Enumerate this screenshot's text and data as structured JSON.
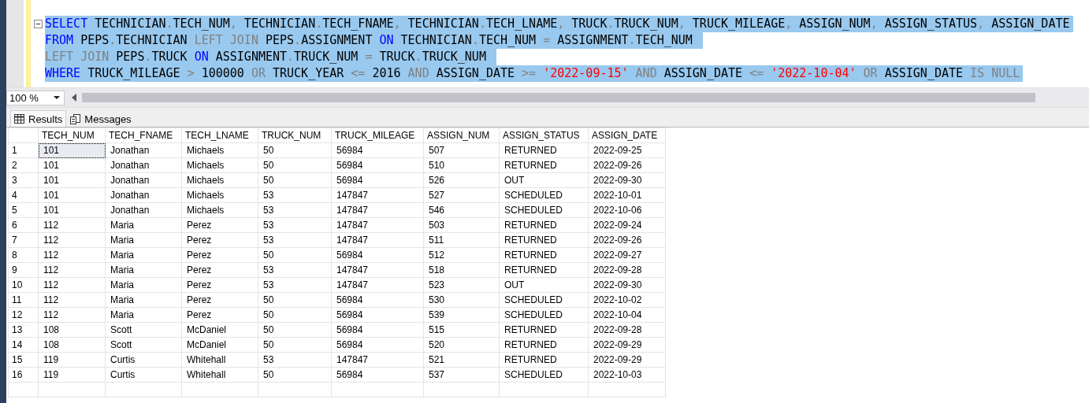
{
  "editor": {
    "lines": [
      {
        "selected": true,
        "collapsible": true,
        "tokens": [
          {
            "kind": "keyword",
            "text": "SELECT"
          },
          {
            "kind": "plain",
            "text": " TECHNICIAN"
          },
          {
            "kind": "gray",
            "text": "."
          },
          {
            "kind": "plain",
            "text": "TECH_NUM"
          },
          {
            "kind": "gray",
            "text": ","
          },
          {
            "kind": "plain",
            "text": " TECHNICIAN"
          },
          {
            "kind": "gray",
            "text": "."
          },
          {
            "kind": "plain",
            "text": "TECH_FNAME"
          },
          {
            "kind": "gray",
            "text": ","
          },
          {
            "kind": "plain",
            "text": " TECHNICIAN"
          },
          {
            "kind": "gray",
            "text": "."
          },
          {
            "kind": "plain",
            "text": "TECH_LNAME"
          },
          {
            "kind": "gray",
            "text": ","
          },
          {
            "kind": "plain",
            "text": " TRUCK"
          },
          {
            "kind": "gray",
            "text": "."
          },
          {
            "kind": "plain",
            "text": "TRUCK_NUM"
          },
          {
            "kind": "gray",
            "text": ","
          },
          {
            "kind": "plain",
            "text": " TRUCK_MILEAGE"
          },
          {
            "kind": "gray",
            "text": ","
          },
          {
            "kind": "plain",
            "text": " ASSIGN_NUM"
          },
          {
            "kind": "gray",
            "text": ","
          },
          {
            "kind": "plain",
            "text": " ASSIGN_STATUS"
          },
          {
            "kind": "gray",
            "text": ","
          },
          {
            "kind": "plain",
            "text": " ASSIGN_DATE"
          }
        ]
      },
      {
        "selected": true,
        "collapsible": false,
        "tokens": [
          {
            "kind": "keyword",
            "text": "FROM"
          },
          {
            "kind": "plain",
            "text": " PEPS"
          },
          {
            "kind": "gray",
            "text": "."
          },
          {
            "kind": "plain",
            "text": "TECHNICIAN "
          },
          {
            "kind": "gray",
            "text": "LEFT JOIN"
          },
          {
            "kind": "plain",
            "text": " PEPS"
          },
          {
            "kind": "gray",
            "text": "."
          },
          {
            "kind": "plain",
            "text": "ASSIGNMENT "
          },
          {
            "kind": "keyword",
            "text": "ON"
          },
          {
            "kind": "plain",
            "text": " TECHNICIAN"
          },
          {
            "kind": "gray",
            "text": "."
          },
          {
            "kind": "plain",
            "text": "TECH_NUM "
          },
          {
            "kind": "gray",
            "text": "="
          },
          {
            "kind": "plain",
            "text": " ASSIGNMENT"
          },
          {
            "kind": "gray",
            "text": "."
          },
          {
            "kind": "plain",
            "text": "TECH_NUM "
          }
        ]
      },
      {
        "selected": true,
        "collapsible": false,
        "tokens": [
          {
            "kind": "gray",
            "text": "LEFT JOIN"
          },
          {
            "kind": "plain",
            "text": " PEPS"
          },
          {
            "kind": "gray",
            "text": "."
          },
          {
            "kind": "plain",
            "text": "TRUCK "
          },
          {
            "kind": "keyword",
            "text": "ON"
          },
          {
            "kind": "plain",
            "text": " ASSIGNMENT"
          },
          {
            "kind": "gray",
            "text": "."
          },
          {
            "kind": "plain",
            "text": "TRUCK_NUM "
          },
          {
            "kind": "gray",
            "text": "="
          },
          {
            "kind": "plain",
            "text": " TRUCK"
          },
          {
            "kind": "gray",
            "text": "."
          },
          {
            "kind": "plain",
            "text": "TRUCK_NUM "
          }
        ]
      },
      {
        "selected": true,
        "collapsible": false,
        "tokens": [
          {
            "kind": "keyword",
            "text": "WHERE"
          },
          {
            "kind": "plain",
            "text": " TRUCK_MILEAGE "
          },
          {
            "kind": "gray",
            "text": ">"
          },
          {
            "kind": "plain",
            "text": " 100000 "
          },
          {
            "kind": "gray",
            "text": "OR"
          },
          {
            "kind": "plain",
            "text": " TRUCK_YEAR "
          },
          {
            "kind": "gray",
            "text": "<="
          },
          {
            "kind": "plain",
            "text": " 2016 "
          },
          {
            "kind": "gray",
            "text": "AND"
          },
          {
            "kind": "plain",
            "text": " ASSIGN_DATE "
          },
          {
            "kind": "gray",
            "text": ">= "
          },
          {
            "kind": "string",
            "text": "'2022-09-15'"
          },
          {
            "kind": "gray",
            "text": " AND"
          },
          {
            "kind": "plain",
            "text": " ASSIGN_DATE "
          },
          {
            "kind": "gray",
            "text": "<= "
          },
          {
            "kind": "string",
            "text": "'2022-10-04'"
          },
          {
            "kind": "gray",
            "text": " OR"
          },
          {
            "kind": "plain",
            "text": " ASSIGN_DATE "
          },
          {
            "kind": "gray",
            "text": "IS NULL"
          }
        ]
      }
    ]
  },
  "zoom": {
    "value": "100 %"
  },
  "result_tabs": [
    {
      "label": "Results",
      "kind": "grid",
      "selected": true
    },
    {
      "label": "Messages",
      "kind": "messages",
      "selected": false
    }
  ],
  "results": {
    "columns": [
      "TECH_NUM",
      "TECH_FNAME",
      "TECH_LNAME",
      "TRUCK_NUM",
      "TRUCK_MILEAGE",
      "ASSIGN_NUM",
      "ASSIGN_STATUS",
      "ASSIGN_DATE"
    ],
    "rows": [
      {
        "number": "1",
        "focused": true,
        "cells": [
          "101",
          "Jonathan",
          "Michaels",
          "50",
          "56984",
          "507",
          "RETURNED",
          "2022-09-25"
        ]
      },
      {
        "number": "2",
        "focused": false,
        "cells": [
          "101",
          "Jonathan",
          "Michaels",
          "50",
          "56984",
          "510",
          "RETURNED",
          "2022-09-26"
        ]
      },
      {
        "number": "3",
        "focused": false,
        "cells": [
          "101",
          "Jonathan",
          "Michaels",
          "50",
          "56984",
          "526",
          "OUT",
          "2022-09-30"
        ]
      },
      {
        "number": "4",
        "focused": false,
        "cells": [
          "101",
          "Jonathan",
          "Michaels",
          "53",
          "147847",
          "527",
          "SCHEDULED",
          "2022-10-01"
        ]
      },
      {
        "number": "5",
        "focused": false,
        "cells": [
          "101",
          "Jonathan",
          "Michaels",
          "53",
          "147847",
          "546",
          "SCHEDULED",
          "2022-10-06"
        ]
      },
      {
        "number": "6",
        "focused": false,
        "cells": [
          "112",
          "Maria",
          "Perez",
          "53",
          "147847",
          "503",
          "RETURNED",
          "2022-09-24"
        ]
      },
      {
        "number": "7",
        "focused": false,
        "cells": [
          "112",
          "Maria",
          "Perez",
          "53",
          "147847",
          "511",
          "RETURNED",
          "2022-09-26"
        ]
      },
      {
        "number": "8",
        "focused": false,
        "cells": [
          "112",
          "Maria",
          "Perez",
          "50",
          "56984",
          "512",
          "RETURNED",
          "2022-09-27"
        ]
      },
      {
        "number": "9",
        "focused": false,
        "cells": [
          "112",
          "Maria",
          "Perez",
          "53",
          "147847",
          "518",
          "RETURNED",
          "2022-09-28"
        ]
      },
      {
        "number": "10",
        "focused": false,
        "cells": [
          "112",
          "Maria",
          "Perez",
          "53",
          "147847",
          "523",
          "OUT",
          "2022-09-30"
        ]
      },
      {
        "number": "11",
        "focused": false,
        "cells": [
          "112",
          "Maria",
          "Perez",
          "50",
          "56984",
          "530",
          "SCHEDULED",
          "2022-10-02"
        ]
      },
      {
        "number": "12",
        "focused": false,
        "cells": [
          "112",
          "Maria",
          "Perez",
          "50",
          "56984",
          "539",
          "SCHEDULED",
          "2022-10-04"
        ]
      },
      {
        "number": "13",
        "focused": false,
        "cells": [
          "108",
          "Scott",
          "McDaniel",
          "50",
          "56984",
          "515",
          "RETURNED",
          "2022-09-28"
        ]
      },
      {
        "number": "14",
        "focused": false,
        "cells": [
          "108",
          "Scott",
          "McDaniel",
          "50",
          "56984",
          "520",
          "RETURNED",
          "2022-09-29"
        ]
      },
      {
        "number": "15",
        "focused": false,
        "cells": [
          "119",
          "Curtis",
          "Whitehall",
          "53",
          "147847",
          "521",
          "RETURNED",
          "2022-09-29"
        ]
      },
      {
        "number": "16",
        "focused": false,
        "cells": [
          "119",
          "Curtis",
          "Whitehall",
          "50",
          "56984",
          "537",
          "SCHEDULED",
          "2022-10-03"
        ]
      }
    ]
  }
}
